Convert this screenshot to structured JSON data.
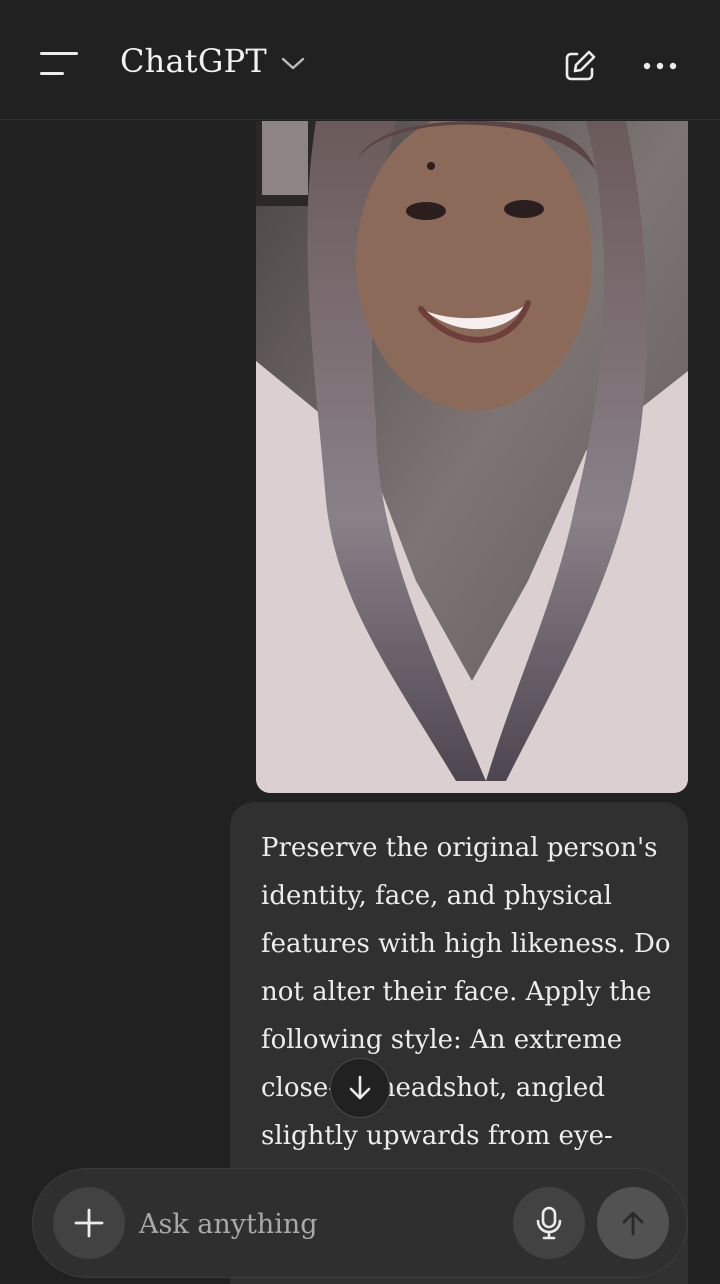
{
  "header": {
    "title": "ChatGPT"
  },
  "icons": {
    "menu": "menu-icon",
    "chevron": "chevron-down-icon",
    "new_chat": "new-chat-icon",
    "more": "more-icon",
    "scroll_down": "arrow-down-icon",
    "plus": "plus-icon",
    "mic": "microphone-icon",
    "send": "arrow-up-icon"
  },
  "message": {
    "text": "Preserve the original person's identity, face, and physical features with high likeness. Do not alter their face. Apply the following style: An extreme close-up headshot, angled slightly upwards from eye-level, focusing"
  },
  "composer": {
    "placeholder": "Ask anything"
  },
  "colors": {
    "background": "#212121",
    "bubble": "#303030",
    "composer": "#2f2f2f",
    "text": "#ececec"
  }
}
